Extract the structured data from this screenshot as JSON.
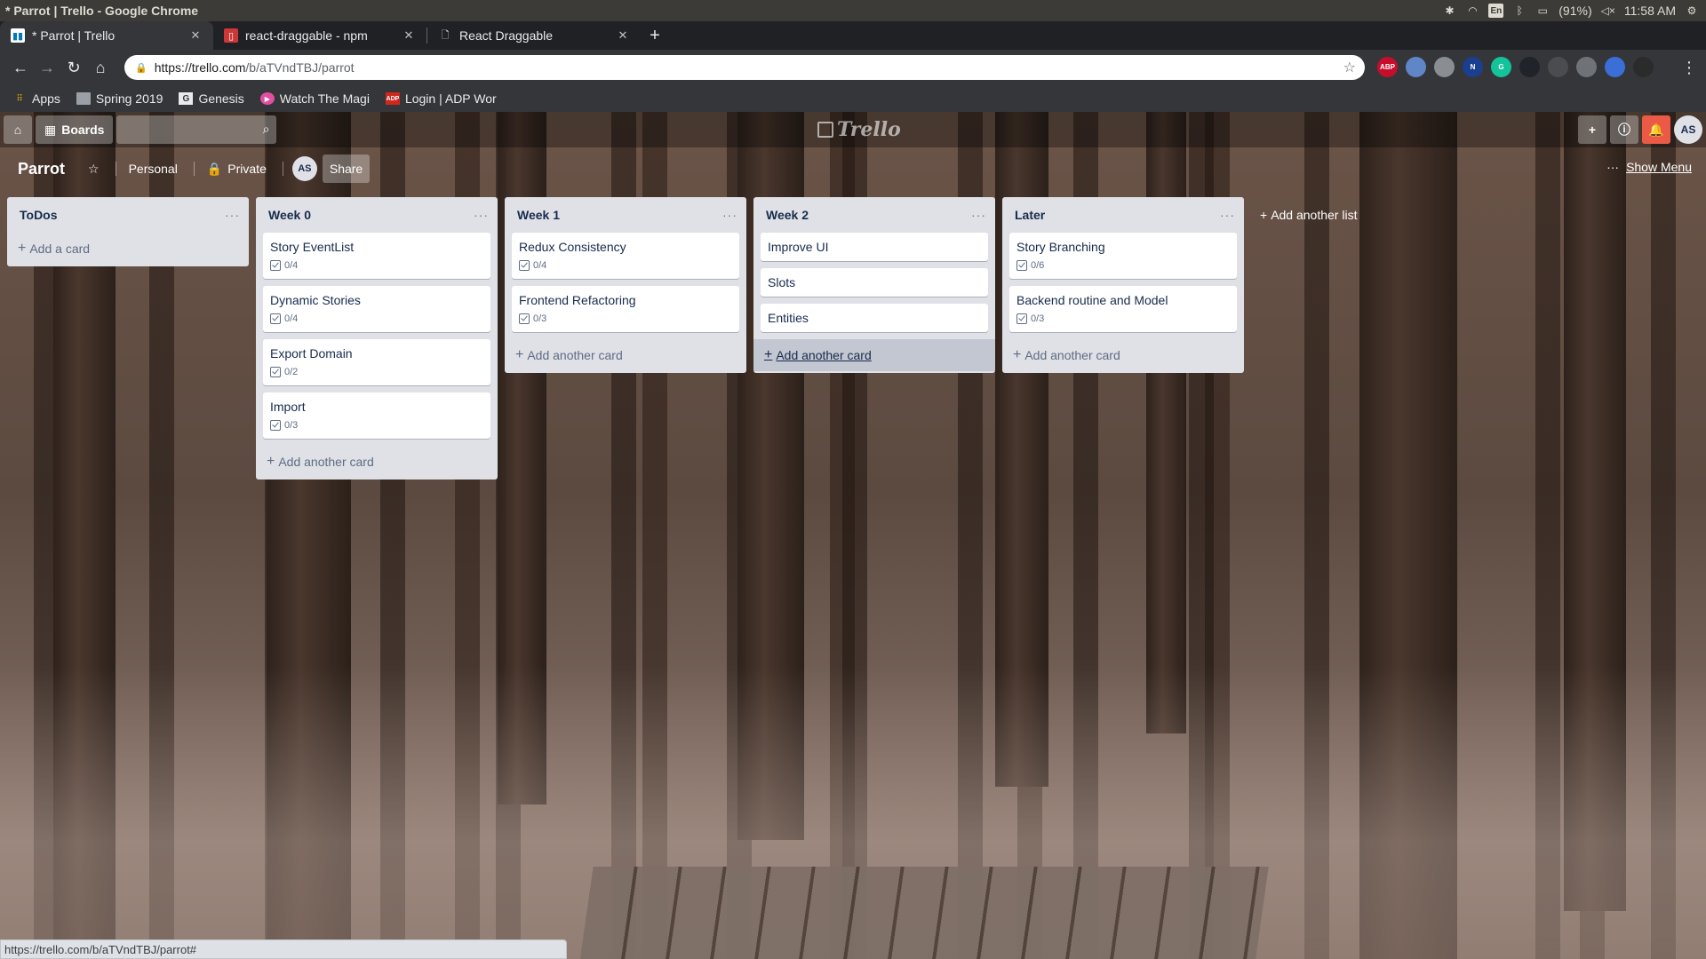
{
  "os": {
    "window_title": "* Parrot | Trello - Google Chrome",
    "keyboard": "En",
    "battery": "(91%)",
    "time": "11:58 AM"
  },
  "browser": {
    "tabs": [
      {
        "title": "* Parrot | Trello",
        "favicon": "trello-icon",
        "active": true
      },
      {
        "title": "react-draggable - npm",
        "favicon": "npm-icon",
        "active": false
      },
      {
        "title": "React Draggable",
        "favicon": "document-icon",
        "active": false
      }
    ],
    "url_host": "https://trello.com",
    "url_path": "/b/aTVndTBJ/parrot",
    "extensions": [
      {
        "name": "abp-icon",
        "label": "ABP",
        "color": "#c70d2c"
      },
      {
        "name": "globe-extension-icon",
        "label": "",
        "color": "#5f86c7"
      },
      {
        "name": "puzzle-extension-icon",
        "label": "",
        "color": "#8a8d91"
      },
      {
        "name": "n-extension-icon",
        "label": "N",
        "color": "#1a3f8f"
      },
      {
        "name": "grammarly-icon",
        "label": "G",
        "color": "#15c39a"
      },
      {
        "name": "react-devtools-icon",
        "label": "",
        "color": "#20232a"
      },
      {
        "name": "bug-extension-icon",
        "label": "",
        "color": "#4a4c50"
      },
      {
        "name": "target-extension-icon",
        "label": "",
        "color": "#6f7378"
      },
      {
        "name": "pen-extension-icon",
        "label": "",
        "color": "#3a6fd8"
      },
      {
        "name": "profile-avatar-icon",
        "label": "",
        "color": "#2b2b2b"
      }
    ]
  },
  "bookmarks": [
    {
      "label": "Apps",
      "icon": "apps-grid-icon"
    },
    {
      "label": "Spring 2019",
      "icon": "folder-icon"
    },
    {
      "label": "Genesis",
      "icon": "genesis-icon"
    },
    {
      "label": "Watch The Magi",
      "icon": "play-icon"
    },
    {
      "label": "Login | ADP Wor",
      "icon": "adp-icon"
    }
  ],
  "trello": {
    "header": {
      "boards_label": "Boards",
      "logo_text": "Trello",
      "avatar": "AS"
    },
    "board": {
      "name": "Parrot",
      "team": "Personal",
      "visibility": "Private",
      "member_avatar": "AS",
      "share_label": "Share",
      "show_menu_label": "Show Menu"
    },
    "lists": [
      {
        "title": "ToDos",
        "cards": [],
        "add_label": "Add a card"
      },
      {
        "title": "Week 0",
        "cards": [
          {
            "title": "Story EventList",
            "checklist": "0/4"
          },
          {
            "title": "Dynamic Stories",
            "checklist": "0/4"
          },
          {
            "title": "Export Domain",
            "checklist": "0/2"
          },
          {
            "title": "Import",
            "checklist": "0/3"
          }
        ],
        "add_label": "Add another card"
      },
      {
        "title": "Week 1",
        "cards": [
          {
            "title": "Redux Consistency",
            "checklist": "0/4"
          },
          {
            "title": "Frontend Refactoring",
            "checklist": "0/3"
          }
        ],
        "add_label": "Add another card"
      },
      {
        "title": "Week 2",
        "cards": [
          {
            "title": "Improve UI",
            "checklist": ""
          },
          {
            "title": "Slots",
            "checklist": ""
          },
          {
            "title": "Entities",
            "checklist": ""
          }
        ],
        "add_label": "Add another card"
      },
      {
        "title": "Later",
        "cards": [
          {
            "title": "Story Branching",
            "checklist": "0/6"
          },
          {
            "title": "Backend routine and Model",
            "checklist": "0/3"
          }
        ],
        "add_label": "Add another card"
      }
    ],
    "add_list_label": "Add another list"
  },
  "status_url": "https://trello.com/b/aTVndTBJ/parrot#"
}
